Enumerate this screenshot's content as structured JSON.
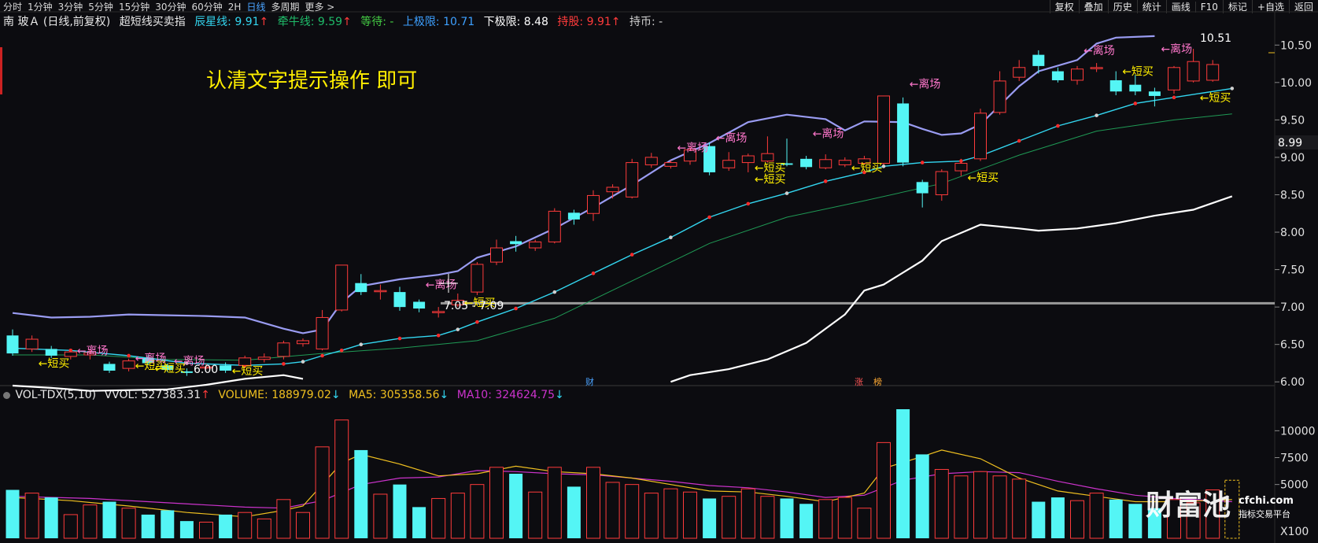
{
  "toolbar": {
    "periods": [
      "分时",
      "1分钟",
      "3分钟",
      "5分钟",
      "15分钟",
      "30分钟",
      "60分钟",
      "2H",
      "日线",
      "多周期",
      "更多 >"
    ],
    "active_period": "日线",
    "tools": [
      "复权",
      "叠加",
      "历史",
      "统计",
      "画线",
      "F10",
      "标记",
      "+自选",
      "返回"
    ]
  },
  "info": {
    "stock": "南 玻Ａ (日线,前复权)",
    "indicator": "超短线买卖指",
    "chenxing_label": "辰星线: ",
    "chenxing_val": "9.91",
    "qianniu_label": "牵牛线: ",
    "qianniu_val": "9.59",
    "dengdai": "等待: -",
    "upper": "上极限: 10.71",
    "lower": "下极限: 8.48",
    "chigu": "持股: 9.91",
    "chibi": "持币: -",
    "arrow_up": "↑",
    "arrow_down": "↓",
    "colors": {
      "chenxing": "#33d6f0",
      "qianniu": "#1fbd6a",
      "dengdai": "#44cc44",
      "upper": "#3da0ff",
      "lower": "#ffffff",
      "chigu": "#ff3b3b",
      "chibi": "#cfcfcf",
      "up_arrow": "#ff3b3b"
    }
  },
  "volume_info": {
    "name": "VOL-TDX(5,10)",
    "vvol": "VVOL: 527383.31",
    "volume": "VOLUME: 188979.02",
    "ma5": "MA5: 305358.56",
    "ma10": "MA10: 324624.75",
    "arrow_up": "↑",
    "arrow_down": "↓",
    "colors": {
      "volume": "#f0c020",
      "ma5": "#f0c020",
      "ma10": "#cc33cc"
    }
  },
  "annotation": "认清文字提示操作 即可",
  "price_axis": [
    "10.50",
    "10.00",
    "9.50",
    "9.00",
    "8.50",
    "8.00",
    "7.50",
    "7.00",
    "6.50",
    "6.00"
  ],
  "current_price": "8.99",
  "volume_axis": [
    "10000",
    "7500",
    "5000"
  ],
  "volume_unit": "X100",
  "max_label": "10.51",
  "min_label": "6.00",
  "range_label": "7.05 - 7.09",
  "signal_labels": {
    "leave": "←离场",
    "buy": "←短买"
  },
  "event_labels": [
    "财",
    "涨",
    "榜"
  ],
  "watermark": {
    "brand": "财富池",
    "site": "cfchi.com",
    "tagline": "指标交易平台"
  },
  "bottom_strip": "(partially visible indicator row)",
  "chart_data": {
    "type": "candlestick",
    "ylim": [
      5.95,
      10.65
    ],
    "volume_ylim": [
      0,
      12000
    ],
    "candles": [
      {
        "o": 6.62,
        "c": 6.38,
        "h": 6.7,
        "l": 6.35,
        "v": 4500
      },
      {
        "o": 6.44,
        "c": 6.57,
        "h": 6.62,
        "l": 6.4,
        "v": 4200
      },
      {
        "o": 6.44,
        "c": 6.35,
        "h": 6.48,
        "l": 6.32,
        "v": 3800
      },
      {
        "o": 6.34,
        "c": 6.4,
        "h": 6.43,
        "l": 6.3,
        "v": 2200
      },
      {
        "o": 6.36,
        "c": 6.39,
        "h": 6.44,
        "l": 6.3,
        "v": 3100
      },
      {
        "o": 6.24,
        "c": 6.15,
        "h": 6.27,
        "l": 6.12,
        "v": 3400
      },
      {
        "o": 6.18,
        "c": 6.28,
        "h": 6.31,
        "l": 6.14,
        "v": 2800
      },
      {
        "o": 6.32,
        "c": 6.25,
        "h": 6.36,
        "l": 6.22,
        "v": 2200
      },
      {
        "o": 6.22,
        "c": 6.16,
        "h": 6.25,
        "l": 6.13,
        "v": 2600
      },
      {
        "o": 6.14,
        "c": 6.12,
        "h": 6.18,
        "l": 6.08,
        "v": 1600
      },
      {
        "o": 6.19,
        "c": 6.2,
        "h": 6.24,
        "l": 6.17,
        "v": 1500
      },
      {
        "o": 6.22,
        "c": 6.15,
        "h": 6.26,
        "l": 6.12,
        "v": 2200
      },
      {
        "o": 6.22,
        "c": 6.32,
        "h": 6.35,
        "l": 6.18,
        "v": 2400
      },
      {
        "o": 6.3,
        "c": 6.33,
        "h": 6.38,
        "l": 6.26,
        "v": 1800
      },
      {
        "o": 6.34,
        "c": 6.52,
        "h": 6.55,
        "l": 6.3,
        "v": 3600
      },
      {
        "o": 6.51,
        "c": 6.55,
        "h": 6.58,
        "l": 6.47,
        "v": 2400
      },
      {
        "o": 6.44,
        "c": 6.86,
        "h": 6.96,
        "l": 6.42,
        "v": 8500
      },
      {
        "o": 6.96,
        "c": 7.56,
        "h": 7.56,
        "l": 6.94,
        "v": 11000
      },
      {
        "o": 7.32,
        "c": 7.2,
        "h": 7.44,
        "l": 7.16,
        "v": 8200
      },
      {
        "o": 7.22,
        "c": 7.22,
        "h": 7.3,
        "l": 7.1,
        "v": 4100
      },
      {
        "o": 7.2,
        "c": 7.0,
        "h": 7.27,
        "l": 6.95,
        "v": 5000
      },
      {
        "o": 7.07,
        "c": 6.98,
        "h": 7.1,
        "l": 6.93,
        "v": 2900
      },
      {
        "o": 6.93,
        "c": 6.94,
        "h": 7.0,
        "l": 6.86,
        "v": 3700
      },
      {
        "o": 7.03,
        "c": 7.09,
        "h": 7.18,
        "l": 7.0,
        "v": 4200
      },
      {
        "o": 7.2,
        "c": 7.57,
        "h": 7.6,
        "l": 7.16,
        "v": 5000
      },
      {
        "o": 7.6,
        "c": 7.79,
        "h": 7.9,
        "l": 7.56,
        "v": 6600
      },
      {
        "o": 7.88,
        "c": 7.84,
        "h": 7.95,
        "l": 7.74,
        "v": 6000
      },
      {
        "o": 7.79,
        "c": 7.87,
        "h": 7.9,
        "l": 7.75,
        "v": 4300
      },
      {
        "o": 7.87,
        "c": 8.28,
        "h": 8.32,
        "l": 7.85,
        "v": 6600
      },
      {
        "o": 8.26,
        "c": 8.17,
        "h": 8.3,
        "l": 8.1,
        "v": 4800
      },
      {
        "o": 8.25,
        "c": 8.49,
        "h": 8.56,
        "l": 8.15,
        "v": 6600
      },
      {
        "o": 8.54,
        "c": 8.6,
        "h": 8.64,
        "l": 8.45,
        "v": 5200
      },
      {
        "o": 8.47,
        "c": 8.93,
        "h": 8.98,
        "l": 8.45,
        "v": 5000
      },
      {
        "o": 8.9,
        "c": 9.0,
        "h": 9.06,
        "l": 8.86,
        "v": 4200
      },
      {
        "o": 8.88,
        "c": 8.93,
        "h": 8.96,
        "l": 8.85,
        "v": 4600
      },
      {
        "o": 8.95,
        "c": 9.1,
        "h": 9.14,
        "l": 8.9,
        "v": 4300
      },
      {
        "o": 9.15,
        "c": 8.8,
        "h": 9.2,
        "l": 8.76,
        "v": 3700
      },
      {
        "o": 8.86,
        "c": 8.96,
        "h": 9.07,
        "l": 8.82,
        "v": 3900
      },
      {
        "o": 8.93,
        "c": 9.02,
        "h": 9.05,
        "l": 8.8,
        "v": 4600
      },
      {
        "o": 8.95,
        "c": 9.05,
        "h": 9.28,
        "l": 8.93,
        "v": 3900
      },
      {
        "o": 8.92,
        "c": 8.9,
        "h": 9.25,
        "l": 8.88,
        "v": 3700
      },
      {
        "o": 8.98,
        "c": 8.87,
        "h": 9.02,
        "l": 8.84,
        "v": 3200
      },
      {
        "o": 8.86,
        "c": 8.97,
        "h": 9.04,
        "l": 8.84,
        "v": 3600
      },
      {
        "o": 8.9,
        "c": 8.96,
        "h": 9.0,
        "l": 8.87,
        "v": 3800
      },
      {
        "o": 8.92,
        "c": 8.98,
        "h": 9.02,
        "l": 8.9,
        "v": 2800
      },
      {
        "o": 8.92,
        "c": 9.82,
        "h": 9.82,
        "l": 8.9,
        "v": 8900
      },
      {
        "o": 9.72,
        "c": 8.93,
        "h": 9.8,
        "l": 8.88,
        "v": 12000
      },
      {
        "o": 8.67,
        "c": 8.52,
        "h": 8.7,
        "l": 8.33,
        "v": 7800
      },
      {
        "o": 8.5,
        "c": 8.81,
        "h": 8.84,
        "l": 8.42,
        "v": 6400
      },
      {
        "o": 8.82,
        "c": 8.92,
        "h": 8.98,
        "l": 8.75,
        "v": 5800
      },
      {
        "o": 8.98,
        "c": 9.59,
        "h": 9.65,
        "l": 8.95,
        "v": 6200
      },
      {
        "o": 9.6,
        "c": 10.02,
        "h": 10.15,
        "l": 9.57,
        "v": 5800
      },
      {
        "o": 10.07,
        "c": 10.2,
        "h": 10.3,
        "l": 10.02,
        "v": 5500
      },
      {
        "o": 10.37,
        "c": 10.22,
        "h": 10.43,
        "l": 10.12,
        "v": 3400
      },
      {
        "o": 10.15,
        "c": 10.03,
        "h": 10.2,
        "l": 10.0,
        "v": 3800
      },
      {
        "o": 10.03,
        "c": 10.18,
        "h": 10.22,
        "l": 9.97,
        "v": 3500
      },
      {
        "o": 10.2,
        "c": 10.2,
        "h": 10.26,
        "l": 10.14,
        "v": 4200
      },
      {
        "o": 10.03,
        "c": 9.88,
        "h": 10.15,
        "l": 9.83,
        "v": 3600
      },
      {
        "o": 9.97,
        "c": 9.88,
        "h": 10.1,
        "l": 9.83,
        "v": 3200
      },
      {
        "o": 9.88,
        "c": 9.82,
        "h": 9.93,
        "l": 9.68,
        "v": 2800
      },
      {
        "o": 9.9,
        "c": 10.2,
        "h": 10.22,
        "l": 9.85,
        "v": 3600
      },
      {
        "o": 10.02,
        "c": 10.28,
        "h": 10.45,
        "l": 10.0,
        "v": 3300
      },
      {
        "o": 10.03,
        "c": 10.24,
        "h": 10.3,
        "l": 10.01,
        "v": 4500
      }
    ],
    "lines": {
      "upper_band": [
        [
          0,
          6.92
        ],
        [
          2,
          6.86
        ],
        [
          4,
          6.87
        ],
        [
          6,
          6.9
        ],
        [
          8,
          6.89
        ],
        [
          10,
          6.88
        ],
        [
          12,
          6.86
        ],
        [
          14,
          6.71
        ],
        [
          15,
          6.65
        ],
        [
          16,
          6.7
        ],
        [
          17,
          7.06
        ],
        [
          18,
          7.28
        ],
        [
          20,
          7.37
        ],
        [
          22,
          7.43
        ],
        [
          23,
          7.48
        ],
        [
          24,
          7.66
        ],
        [
          26,
          7.81
        ],
        [
          28,
          8.05
        ],
        [
          30,
          8.33
        ],
        [
          32,
          8.63
        ],
        [
          34,
          8.96
        ],
        [
          36,
          9.19
        ],
        [
          38,
          9.47
        ],
        [
          40,
          9.57
        ],
        [
          42,
          9.51
        ],
        [
          43,
          9.36
        ],
        [
          44,
          9.48
        ],
        [
          46,
          9.47
        ],
        [
          47,
          9.38
        ],
        [
          48,
          9.3
        ],
        [
          49,
          9.32
        ],
        [
          50,
          9.44
        ],
        [
          52,
          9.95
        ],
        [
          53,
          10.15
        ],
        [
          55,
          10.3
        ],
        [
          56,
          10.52
        ],
        [
          57,
          10.6
        ],
        [
          59,
          10.62
        ]
      ],
      "trend_dotted": [
        [
          0,
          6.45
        ],
        [
          3,
          6.42
        ],
        [
          6,
          6.35
        ],
        [
          9,
          6.25
        ],
        [
          12,
          6.22
        ],
        [
          14,
          6.24
        ],
        [
          15,
          6.27
        ],
        [
          16,
          6.35
        ],
        [
          17,
          6.42
        ],
        [
          18,
          6.5
        ],
        [
          20,
          6.58
        ],
        [
          22,
          6.62
        ],
        [
          23,
          6.7
        ],
        [
          24,
          6.8
        ],
        [
          26,
          6.98
        ],
        [
          28,
          7.2
        ],
        [
          30,
          7.45
        ],
        [
          32,
          7.7
        ],
        [
          34,
          7.93
        ],
        [
          36,
          8.2
        ],
        [
          38,
          8.38
        ],
        [
          40,
          8.52
        ],
        [
          42,
          8.68
        ],
        [
          44,
          8.8
        ],
        [
          45,
          8.88
        ],
        [
          47,
          8.93
        ],
        [
          49,
          8.95
        ],
        [
          50,
          9.02
        ],
        [
          52,
          9.22
        ],
        [
          54,
          9.42
        ],
        [
          56,
          9.56
        ],
        [
          58,
          9.72
        ],
        [
          60,
          9.8
        ],
        [
          63,
          9.92
        ]
      ],
      "slow_green": [
        [
          0,
          6.36
        ],
        [
          4,
          6.36
        ],
        [
          8,
          6.3
        ],
        [
          12,
          6.29
        ],
        [
          16,
          6.38
        ],
        [
          20,
          6.45
        ],
        [
          24,
          6.55
        ],
        [
          28,
          6.85
        ],
        [
          32,
          7.35
        ],
        [
          36,
          7.85
        ],
        [
          40,
          8.2
        ],
        [
          44,
          8.42
        ],
        [
          48,
          8.65
        ],
        [
          52,
          9.03
        ],
        [
          56,
          9.35
        ],
        [
          60,
          9.5
        ],
        [
          63,
          9.58
        ]
      ],
      "white_line": [
        [
          0,
          5.95
        ],
        [
          2,
          5.92
        ],
        [
          4,
          5.88
        ],
        [
          8,
          5.9
        ],
        [
          10,
          5.96
        ],
        [
          12,
          6.04
        ],
        [
          14,
          6.09
        ],
        [
          15,
          6.04
        ],
        [
          34,
          6.0
        ],
        [
          35,
          6.09
        ],
        [
          37,
          6.17
        ],
        [
          39,
          6.3
        ],
        [
          41,
          6.52
        ],
        [
          43,
          6.9
        ],
        [
          44,
          7.22
        ],
        [
          45,
          7.3
        ],
        [
          47,
          7.62
        ],
        [
          48,
          7.88
        ],
        [
          50,
          8.1
        ],
        [
          52,
          8.05
        ],
        [
          53,
          8.02
        ],
        [
          55,
          8.05
        ],
        [
          57,
          8.12
        ],
        [
          59,
          8.22
        ],
        [
          61,
          8.3
        ],
        [
          63,
          8.48
        ]
      ],
      "vol_ma5": [
        [
          0,
          3800
        ],
        [
          3,
          3500
        ],
        [
          6,
          3000
        ],
        [
          9,
          2400
        ],
        [
          12,
          2000
        ],
        [
          14,
          2600
        ],
        [
          15,
          3000
        ],
        [
          16,
          5000
        ],
        [
          17,
          7000
        ],
        [
          18,
          7800
        ],
        [
          20,
          6900
        ],
        [
          22,
          5800
        ],
        [
          24,
          6000
        ],
        [
          26,
          6700
        ],
        [
          28,
          6200
        ],
        [
          30,
          6000
        ],
        [
          32,
          5600
        ],
        [
          34,
          5000
        ],
        [
          36,
          4400
        ],
        [
          38,
          4300
        ],
        [
          40,
          3900
        ],
        [
          42,
          3400
        ],
        [
          44,
          4200
        ],
        [
          45,
          6500
        ],
        [
          47,
          7600
        ],
        [
          48,
          8200
        ],
        [
          50,
          7400
        ],
        [
          52,
          5600
        ],
        [
          54,
          4400
        ],
        [
          56,
          3900
        ],
        [
          58,
          3400
        ],
        [
          60,
          3400
        ],
        [
          63,
          3600
        ]
      ],
      "vol_ma10": [
        [
          0,
          3900
        ],
        [
          4,
          3700
        ],
        [
          8,
          3300
        ],
        [
          12,
          2900
        ],
        [
          14,
          2800
        ],
        [
          16,
          3500
        ],
        [
          18,
          5000
        ],
        [
          20,
          5600
        ],
        [
          22,
          5700
        ],
        [
          24,
          6300
        ],
        [
          26,
          6200
        ],
        [
          28,
          6000
        ],
        [
          30,
          5900
        ],
        [
          32,
          5600
        ],
        [
          34,
          5300
        ],
        [
          36,
          4900
        ],
        [
          38,
          4700
        ],
        [
          40,
          4300
        ],
        [
          42,
          3800
        ],
        [
          44,
          4000
        ],
        [
          46,
          5400
        ],
        [
          48,
          6000
        ],
        [
          50,
          6200
        ],
        [
          52,
          6100
        ],
        [
          54,
          5300
        ],
        [
          56,
          4600
        ],
        [
          58,
          4000
        ],
        [
          60,
          3700
        ],
        [
          63,
          3400
        ]
      ]
    },
    "signals": [
      {
        "i": 1,
        "t": "buy",
        "p": 6.25
      },
      {
        "i": 3,
        "t": "leave",
        "p": 6.42
      },
      {
        "i": 6,
        "t": "buy",
        "p": 6.22
      },
      {
        "i": 6,
        "t": "leave",
        "p": 6.32
      },
      {
        "i": 8,
        "t": "leave",
        "p": 6.28
      },
      {
        "i": 7,
        "t": "buy",
        "p": 6.18
      },
      {
        "i": 11,
        "t": "buy",
        "p": 6.15
      },
      {
        "i": 21,
        "t": "leave",
        "p": 7.3
      },
      {
        "i": 23,
        "t": "buy",
        "p": 7.06
      },
      {
        "i": 34,
        "t": "leave",
        "p": 9.13
      },
      {
        "i": 36,
        "t": "leave",
        "p": 9.26
      },
      {
        "i": 38,
        "t": "buy",
        "p": 8.86
      },
      {
        "i": 38,
        "t": "buy",
        "p": 8.71
      },
      {
        "i": 41,
        "t": "leave",
        "p": 9.32
      },
      {
        "i": 43,
        "t": "buy",
        "p": 8.86
      },
      {
        "i": 46,
        "t": "leave",
        "p": 9.98
      },
      {
        "i": 49,
        "t": "buy",
        "p": 8.73
      },
      {
        "i": 55,
        "t": "leave",
        "p": 10.43
      },
      {
        "i": 57,
        "t": "buy",
        "p": 10.15
      },
      {
        "i": 59,
        "t": "leave",
        "p": 10.45
      },
      {
        "i": 61,
        "t": "buy",
        "p": 9.8
      }
    ],
    "support_level": 7.05,
    "max_marker_index": 62,
    "min_marker_index": 9
  }
}
